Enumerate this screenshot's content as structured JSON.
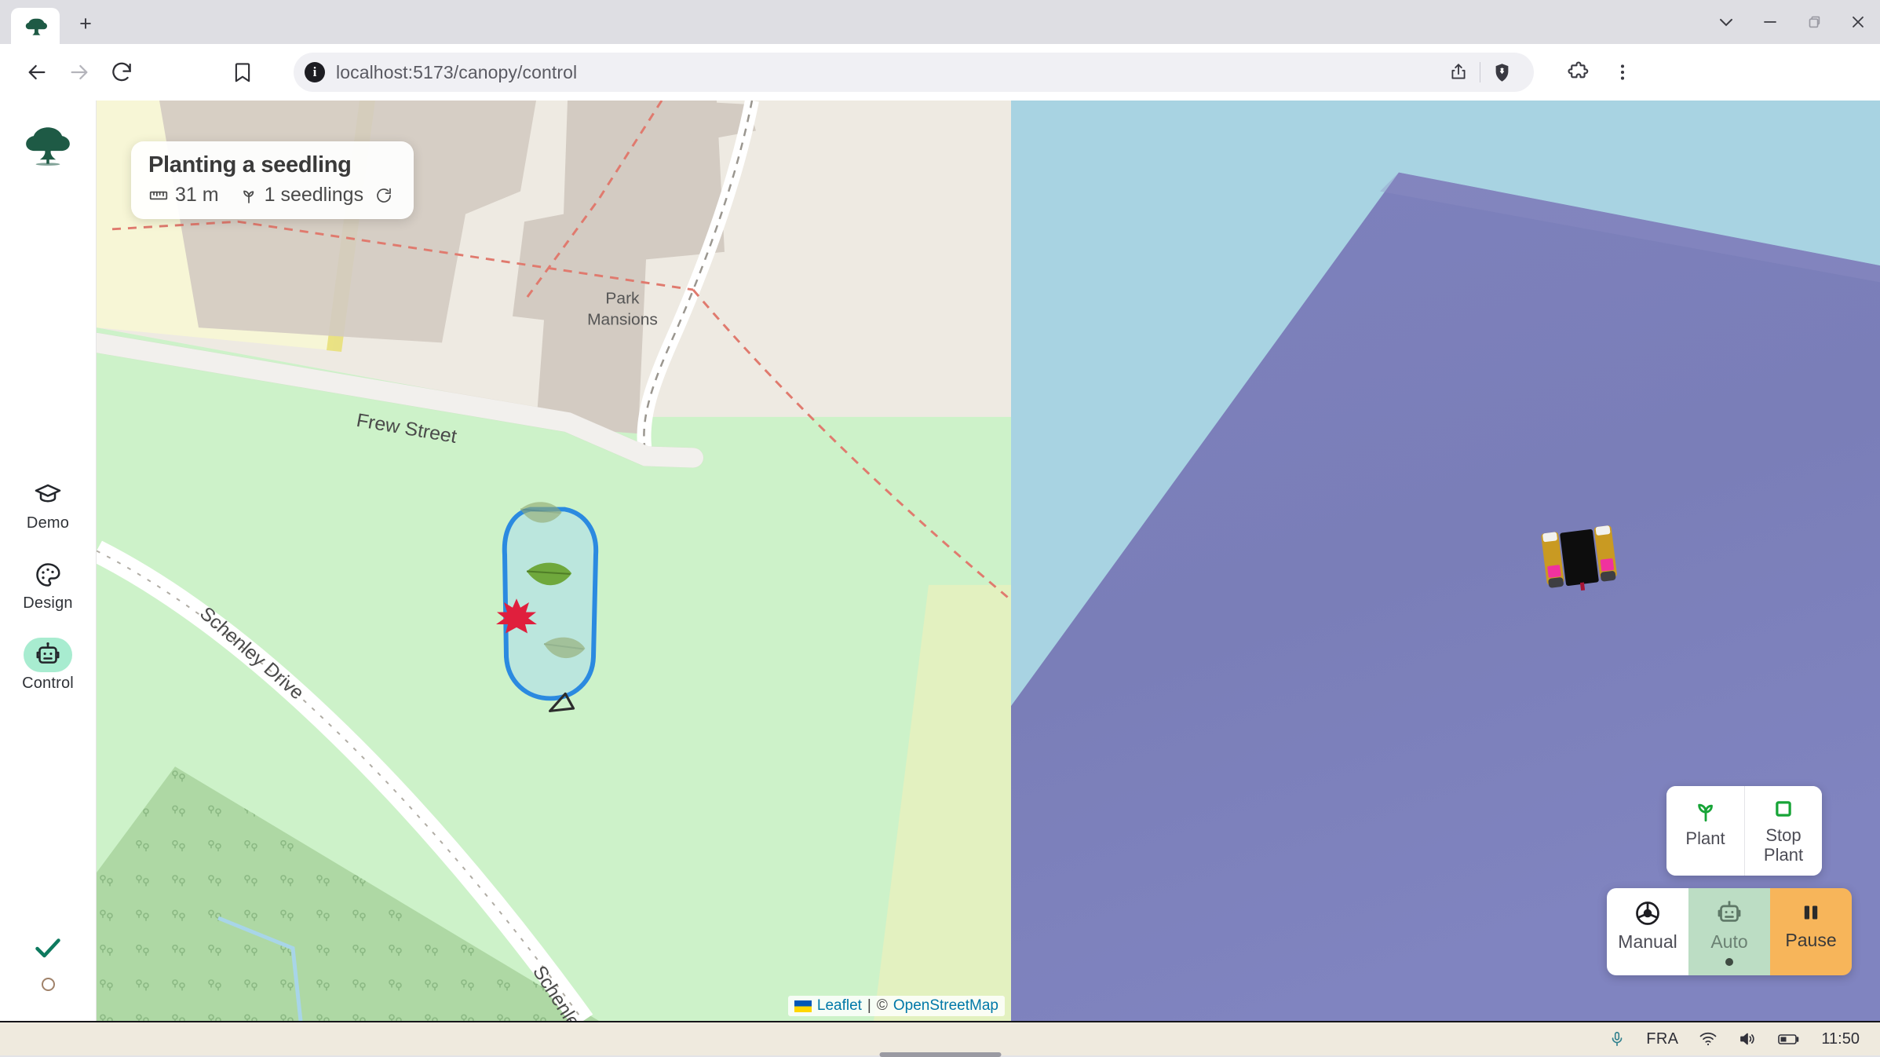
{
  "browser": {
    "tab_icon": "tree-favicon",
    "new_tab_label": "+",
    "window_controls": [
      "chevron-down-icon",
      "minimize-icon",
      "restore-icon",
      "close-icon"
    ],
    "nav": {
      "back": "back-arrow-icon",
      "forward": "forward-arrow-icon",
      "reload": "reload-icon",
      "bookmark": "bookmark-icon"
    },
    "url": "localhost:5173/canopy/control",
    "url_info_badge": "i",
    "url_actions": [
      "share-icon",
      "brave-shields-icon"
    ],
    "toolbar_right": [
      "extensions-icon",
      "browser-menu-icon"
    ]
  },
  "sidebar": {
    "logo": "tree-logo",
    "items": [
      {
        "label": "Demo",
        "icon": "graduation-cap-icon",
        "active": false
      },
      {
        "label": "Design",
        "icon": "palette-icon",
        "active": false
      },
      {
        "label": "Control",
        "icon": "robot-icon",
        "active": true
      }
    ],
    "status": {
      "check_icon": "check-icon",
      "circle_icon": "circle-icon"
    }
  },
  "map": {
    "popup": {
      "title": "Planting a seedling",
      "distance_icon": "ruler-icon",
      "distance": "31 m",
      "seedling_icon": "sprout-icon",
      "seedlings": "1 seedlings",
      "refresh_icon": "refresh-icon"
    },
    "labels": {
      "building": "Park Mansions",
      "street_1": "Frew Street",
      "street_2": "Schenley Drive",
      "street_3": "Schenle"
    },
    "attribution": {
      "flag": "ukraine-flag-icon",
      "leaflet": "Leaflet",
      "separator": "|",
      "copyright": "©",
      "osm": "OpenStreetMap"
    },
    "markers": {
      "planted_leaf": "green-leaf-icon",
      "pending_leaf": "faded-leaf-icon",
      "target_marker": "red-maple-leaf-icon",
      "robot_heading": "robot-heading-arrow-icon"
    },
    "colors": {
      "zone_stroke": "#2b8ae0",
      "zone_fill": "#b4e0e4",
      "park_green": "#cdf2c9",
      "forest_green": "#aed8a4",
      "building": "#d3cbc2",
      "road": "#ffffff",
      "land": "#eeeae2"
    }
  },
  "sim": {
    "sky_color": "#a8d3e2",
    "ground_color": "#7b7fba",
    "robot": {
      "name": "tracked-planting-robot",
      "body_color": "#0d0d0d",
      "tread_color": "#c99a22",
      "accent_color": "#f0329e"
    },
    "plant_controls": [
      {
        "label": "Plant",
        "icon": "sprout-icon"
      },
      {
        "label": "Stop Plant",
        "icon": "stop-square-icon"
      }
    ],
    "mode_controls": [
      {
        "label": "Manual",
        "icon": "steering-wheel-icon",
        "state": "inactive"
      },
      {
        "label": "Auto",
        "icon": "robot-icon",
        "state": "selected"
      },
      {
        "label": "Pause",
        "icon": "pause-icon",
        "state": "active"
      }
    ]
  },
  "taskbar": {
    "mic_icon": "microphone-icon",
    "language": "FRA",
    "wifi_icon": "wifi-icon",
    "volume_icon": "speaker-icon",
    "battery_icon": "battery-icon",
    "clock": "11:50"
  }
}
